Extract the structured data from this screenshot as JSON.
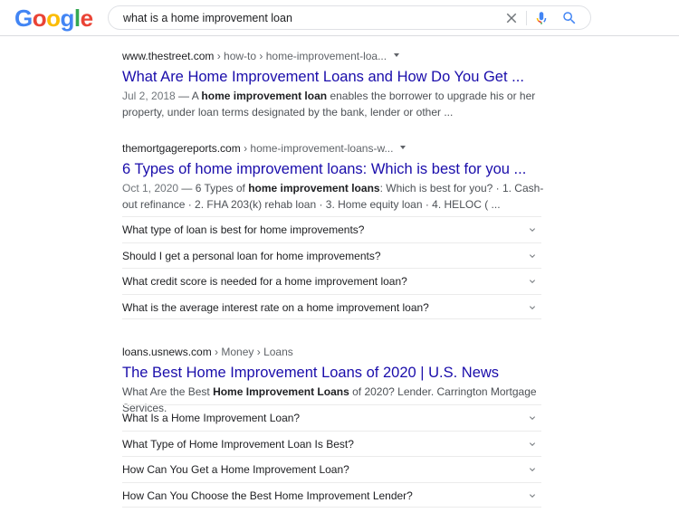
{
  "logo": {
    "letters": [
      "G",
      "o",
      "o",
      "g",
      "l",
      "e"
    ],
    "colors": [
      "#4285F4",
      "#EA4335",
      "#FBBC05",
      "#4285F4",
      "#34A853",
      "#EA4335"
    ]
  },
  "search": {
    "query": "what is a home improvement loan",
    "icons": [
      "close-icon",
      "mic-icon",
      "search-icon"
    ]
  },
  "results": [
    {
      "site": "www.thestreet.com",
      "path": " › how-to › home-improvement-loa...",
      "title": "What Are Home Improvement Loans and How Do You Get ...",
      "date": "Jul 2, 2018",
      "snippet_parts": [
        " — A ",
        "home improvement loan",
        " enables the borrower to upgrade his or her property, under loan terms designated by the bank, lender or other ..."
      ]
    },
    {
      "site": "themortgagereports.com",
      "path": " › home-improvement-loans-w...",
      "title": "6 Types of home improvement loans: Which is best for you ...",
      "date": "Oct 1, 2020",
      "snippet_parts": [
        " — 6 Types of ",
        "home improvement loans",
        ": Which is best for you? · 1. Cash-out refinance · 2. FHA 203(k) rehab loan · 3. Home equity loan · 4. HELOC ( ..."
      ],
      "questions": [
        "What type of loan is best for home improvements?",
        "Should I get a personal loan for home improvements?",
        "What credit score is needed for a home improvement loan?",
        "What is the average interest rate on a home improvement loan?"
      ]
    },
    {
      "site": "loans.usnews.com",
      "path": " › Money › Loans",
      "title": "The Best Home Improvement Loans of 2020 | U.S. News",
      "snippet_parts": [
        "What Are the Best ",
        "Home Improvement Loans",
        " of 2020? Lender. Carrington Mortgage Services."
      ],
      "questions": [
        "What Is a Home Improvement Loan?",
        "What Type of Home Improvement Loan Is Best?",
        "How Can You Get a Home Improvement Loan?",
        "How Can You Choose the Best Home Improvement Lender?"
      ]
    }
  ]
}
